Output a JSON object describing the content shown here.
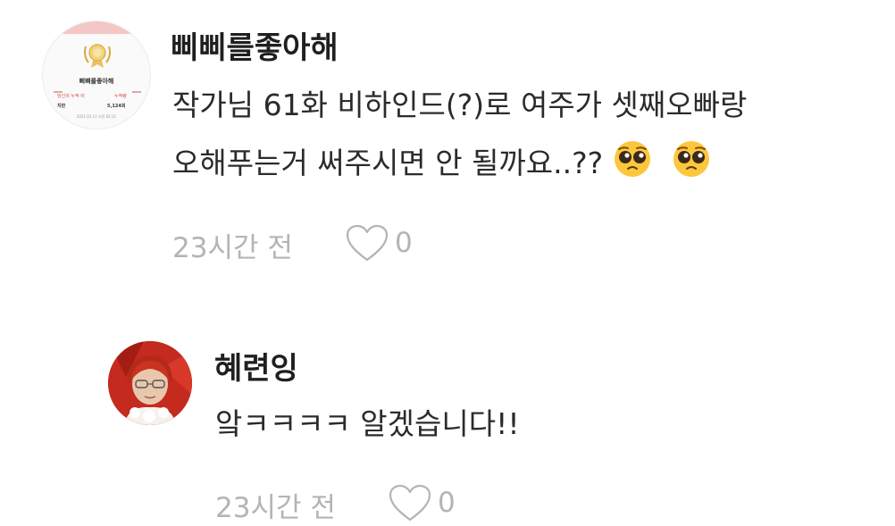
{
  "comments": [
    {
      "author": "삐삐를좋아해",
      "text_line1": "작가님 61화 비하인드(?)로 여주가 셋째오빠랑",
      "text_line2": "오해푸는거 써주시면 안 될까요..??",
      "time": "23시간 전",
      "likes": "0",
      "avatar_certificate": {
        "name": "삐삐를좋아해",
        "label_left": "당신의 누적 이",
        "label_right": "누적량",
        "row_left": "지만",
        "row_value": "5,124회",
        "date": "2021.02.11 오전 02:21"
      }
    },
    {
      "author": "혜련잉",
      "text_line1": "앜ㅋㅋㅋㅋ 알겠습니다!!",
      "time": "23시간 전",
      "likes": "0"
    }
  ],
  "icons": {
    "heart": "heart-outline-icon",
    "emoji": "pleading-face-emoji"
  },
  "colors": {
    "meta_gray": "#b4b4b4",
    "name": "#1f1f1f",
    "body": "#2b2b2b"
  }
}
